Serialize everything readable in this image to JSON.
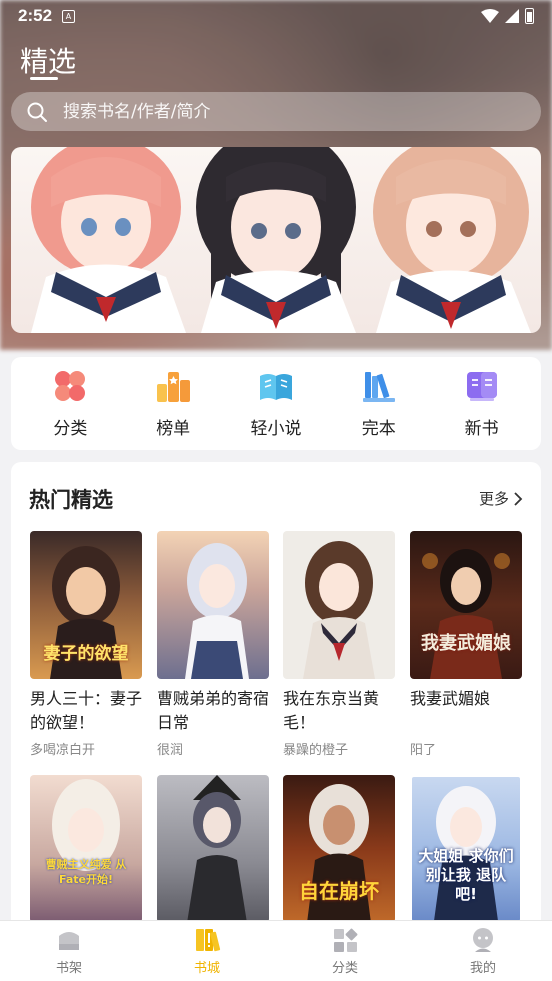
{
  "status_bar": {
    "time": "2:52",
    "badge": "A"
  },
  "header": {
    "title": "精选"
  },
  "search": {
    "placeholder": "搜索书名/作者/简介"
  },
  "quick_nav": [
    {
      "label": "分类",
      "icon": "category-icon",
      "color": "#f26a6a"
    },
    {
      "label": "榜单",
      "icon": "ranking-icon",
      "color": "#f7a13b"
    },
    {
      "label": "轻小说",
      "icon": "light-novel-icon",
      "color": "#4bb8e8"
    },
    {
      "label": "完本",
      "icon": "finished-books-icon",
      "color": "#3f8fe8"
    },
    {
      "label": "新书",
      "icon": "new-book-icon",
      "color": "#8c6cf0"
    }
  ],
  "hot": {
    "title": "热门精选",
    "more": "更多",
    "books": [
      {
        "title": "男人三十：妻子的欲望！",
        "author": "多喝凉白开",
        "cover_text": "妻子的欲望"
      },
      {
        "title": "曹贼弟弟的寄宿日常",
        "author": "很润",
        "cover_text": ""
      },
      {
        "title": "我在东京当黄毛！",
        "author": "暴躁的橙子",
        "cover_text": ""
      },
      {
        "title": "我妻武媚娘",
        "author": "阳了",
        "cover_text": "我妻武媚娘"
      },
      {
        "title": "",
        "author": "",
        "cover_text": "曹贼主义纯爱 从Fate开始!"
      },
      {
        "title": "",
        "author": "",
        "cover_text": ""
      },
      {
        "title": "",
        "author": "",
        "cover_text": "自在崩坏"
      },
      {
        "title": "",
        "author": "",
        "cover_text": "大姐姐 求你们别让我 退队吧!"
      }
    ]
  },
  "tabs": [
    {
      "label": "书架",
      "icon": "bookshelf-icon",
      "active": false
    },
    {
      "label": "书城",
      "icon": "bookstore-icon",
      "active": true
    },
    {
      "label": "分类",
      "icon": "category-tab-icon",
      "active": false
    },
    {
      "label": "我的",
      "icon": "profile-icon",
      "active": false
    }
  ],
  "colors": {
    "accent": "#f0b400",
    "background": "#f2f2f4"
  }
}
